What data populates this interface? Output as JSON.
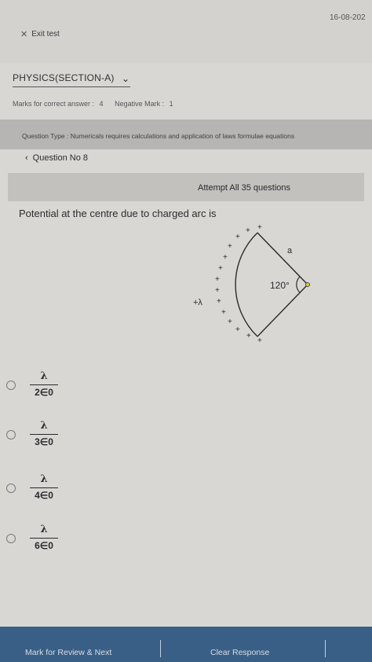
{
  "header": {
    "date": "16-08-202",
    "exit_label": "Exit test"
  },
  "section": {
    "title": "PHYSICS(SECTION-A)",
    "marks_correct_label": "Marks for correct answer :",
    "marks_correct_value": "4",
    "negative_label": "Negative Mark :",
    "negative_value": "1"
  },
  "question_type": "Question Type : Numericals requires calculations and application of laws formulae equations",
  "question_no": "Question No 8",
  "attempt_text": "Attempt All 35 questions",
  "question_text": "Potential at the centre due to charged arc is",
  "diagram": {
    "angle_label": "120°",
    "radius_label": "a",
    "charge_label": "+λ"
  },
  "options": [
    {
      "numerator": "λ",
      "denominator": "2∈0"
    },
    {
      "numerator": "λ",
      "denominator": "3∈0"
    },
    {
      "numerator": "λ",
      "denominator": "4∈0"
    },
    {
      "numerator": "λ",
      "denominator": "6∈0"
    }
  ],
  "footer": {
    "review_label": "Mark for Review & Next",
    "clear_label": "Clear Response"
  },
  "colors": {
    "footer_bg": "#3a5f86",
    "page_bg": "#d9d7d3"
  }
}
